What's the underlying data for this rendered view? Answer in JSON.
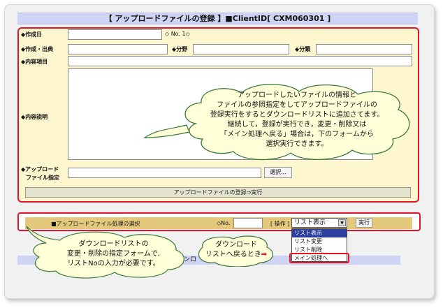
{
  "title": "【 アップロードファイルの登録 】■ClientID[ CXM060301 ]",
  "form": {
    "created_date_label": "◆作成日",
    "no_label": "◇ No. 1◇",
    "creation_source_label": "◆作成・出典",
    "field_label": "◆分野",
    "category_label": "◆分類",
    "content_item_label": "◆内容項目",
    "content_desc_label": "◆内容説明",
    "upload_label_1": "◆アップロード",
    "upload_label_2": "ファイル指定",
    "select_button": "選択...",
    "register_button": "アップロードファイルの登録⇒実行"
  },
  "callout1": {
    "lines": [
      "アップロードしたいファイルの情報と",
      "ファイルの参照指定をしてアップロードファイルの",
      "登録実行をするとダウンロードリストに追加さてます。",
      "継続して，登録が実行でき，変更・削除又は",
      "「メイン処理へ戻る」場合は，下のフォームから",
      "選択実行できます。"
    ]
  },
  "selection": {
    "heading": "■アップロードファイル処理の選択",
    "no_label": "◇No.",
    "operation_label": "[ 操作 ]",
    "selected": "リスト表示",
    "execute_button": "実行",
    "options": [
      "リスト表示",
      "リスト変更",
      "リスト削除",
      "メイン処理へ"
    ]
  },
  "bottom_fragment": "ンロ",
  "callout2": {
    "lines": [
      "ダウンロードリストの",
      "変更・削除の指定フォームで,",
      "リストNoの入力が必要です。"
    ]
  },
  "callout3": {
    "lines": [
      "ダウンロード",
      "リストへ戻るとき"
    ],
    "arrow": "➡"
  },
  "colors": {
    "accent_red": "#e0142a",
    "form_bg": "#fdf6cf",
    "title_bg": "#cfd3f4",
    "selection_bar": "#e4c97c",
    "highlight": "#2d3e9e"
  }
}
